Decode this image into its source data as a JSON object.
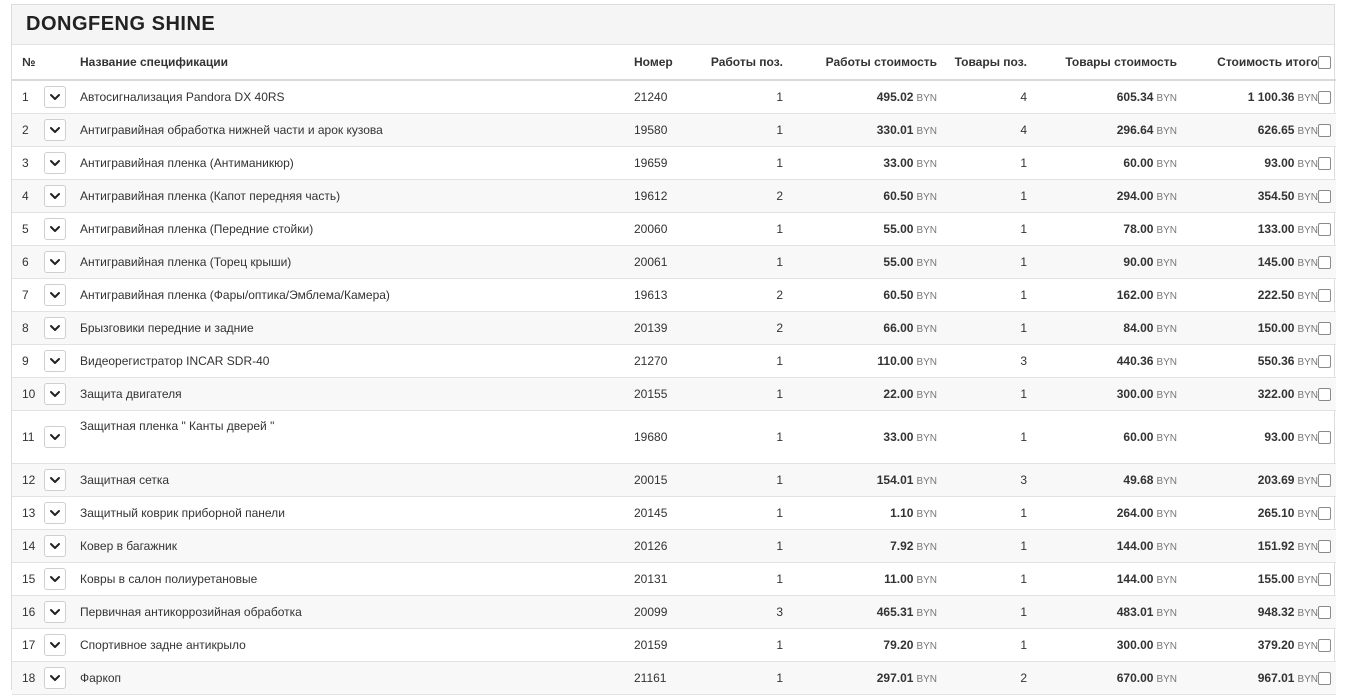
{
  "title": "DONGFENG SHINE",
  "currency": "BYN",
  "columns": {
    "num": "№",
    "name": "Название спецификации",
    "code": "Номер",
    "work_qty": "Работы поз.",
    "work_cost": "Работы стоимость",
    "goods_qty": "Товары поз.",
    "goods_cost": "Товары стоимость",
    "total": "Стоимость итого"
  },
  "rows": [
    {
      "num": "1",
      "name": "Автосигнализация Pandora DX 40RS",
      "code": "21240",
      "work_qty": "1",
      "work_cost": "495.02",
      "goods_qty": "4",
      "goods_cost": "605.34",
      "total": "1 100.36"
    },
    {
      "num": "2",
      "name": "Антигравийная обработка нижней части и арок кузова",
      "code": "19580",
      "work_qty": "1",
      "work_cost": "330.01",
      "goods_qty": "4",
      "goods_cost": "296.64",
      "total": "626.65"
    },
    {
      "num": "3",
      "name": "Антигравийная пленка (Антиманикюр)",
      "code": "19659",
      "work_qty": "1",
      "work_cost": "33.00",
      "goods_qty": "1",
      "goods_cost": "60.00",
      "total": "93.00"
    },
    {
      "num": "4",
      "name": "Антигравийная пленка (Капот передняя часть)",
      "code": "19612",
      "work_qty": "2",
      "work_cost": "60.50",
      "goods_qty": "1",
      "goods_cost": "294.00",
      "total": "354.50"
    },
    {
      "num": "5",
      "name": "Антигравийная пленка (Передние стойки)",
      "code": "20060",
      "work_qty": "1",
      "work_cost": "55.00",
      "goods_qty": "1",
      "goods_cost": "78.00",
      "total": "133.00"
    },
    {
      "num": "6",
      "name": "Антигравийная пленка (Торец крыши)",
      "code": "20061",
      "work_qty": "1",
      "work_cost": "55.00",
      "goods_qty": "1",
      "goods_cost": "90.00",
      "total": "145.00"
    },
    {
      "num": "7",
      "name": "Антигравийная пленка (Фары/оптика/Эмблема/Камера)",
      "code": "19613",
      "work_qty": "2",
      "work_cost": "60.50",
      "goods_qty": "1",
      "goods_cost": "162.00",
      "total": "222.50"
    },
    {
      "num": "8",
      "name": "Брызговики передние и задние",
      "code": "20139",
      "work_qty": "2",
      "work_cost": "66.00",
      "goods_qty": "1",
      "goods_cost": "84.00",
      "total": "150.00"
    },
    {
      "num": "9",
      "name": "Видеорегистратор INCAR SDR-40",
      "code": "21270",
      "work_qty": "1",
      "work_cost": "110.00",
      "goods_qty": "3",
      "goods_cost": "440.36",
      "total": "550.36"
    },
    {
      "num": "10",
      "name": "Защита двигателя",
      "code": "20155",
      "work_qty": "1",
      "work_cost": "22.00",
      "goods_qty": "1",
      "goods_cost": "300.00",
      "total": "322.00"
    },
    {
      "num": "11",
      "name": "Защитная пленка \" Канты дверей \"",
      "code": "19680",
      "work_qty": "1",
      "work_cost": "33.00",
      "goods_qty": "1",
      "goods_cost": "60.00",
      "total": "93.00",
      "tall": true
    },
    {
      "num": "12",
      "name": "Защитная сетка",
      "code": "20015",
      "work_qty": "1",
      "work_cost": "154.01",
      "goods_qty": "3",
      "goods_cost": "49.68",
      "total": "203.69"
    },
    {
      "num": "13",
      "name": "Защитный коврик приборной панели",
      "code": "20145",
      "work_qty": "1",
      "work_cost": "1.10",
      "goods_qty": "1",
      "goods_cost": "264.00",
      "total": "265.10"
    },
    {
      "num": "14",
      "name": "Ковер в багажник",
      "code": "20126",
      "work_qty": "1",
      "work_cost": "7.92",
      "goods_qty": "1",
      "goods_cost": "144.00",
      "total": "151.92"
    },
    {
      "num": "15",
      "name": "Ковры в салон полиуретановые",
      "code": "20131",
      "work_qty": "1",
      "work_cost": "11.00",
      "goods_qty": "1",
      "goods_cost": "144.00",
      "total": "155.00"
    },
    {
      "num": "16",
      "name": "Первичная антикоррозийная обработка",
      "code": "20099",
      "work_qty": "3",
      "work_cost": "465.31",
      "goods_qty": "1",
      "goods_cost": "483.01",
      "total": "948.32"
    },
    {
      "num": "17",
      "name": "Спортивное задне антикрыло",
      "code": "20159",
      "work_qty": "1",
      "work_cost": "79.20",
      "goods_qty": "1",
      "goods_cost": "300.00",
      "total": "379.20"
    },
    {
      "num": "18",
      "name": "Фаркоп",
      "code": "21161",
      "work_qty": "1",
      "work_cost": "297.01",
      "goods_qty": "2",
      "goods_cost": "670.00",
      "total": "967.01"
    }
  ]
}
